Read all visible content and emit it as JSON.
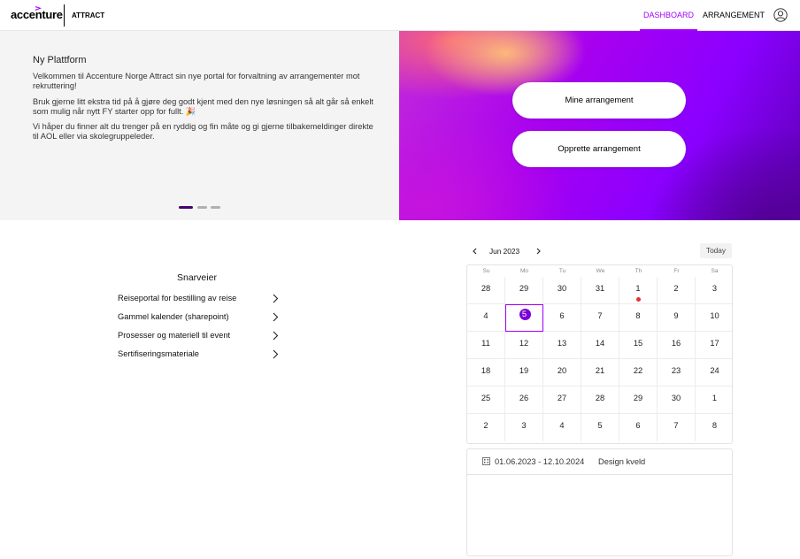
{
  "header": {
    "logo": "accenture",
    "app_name": "ATTRACT",
    "nav": {
      "dashboard": "DASHBOARD",
      "arrangement": "ARRANGEMENT"
    },
    "active_tab": "DASHBOARD",
    "accent_color": "#a100ff",
    "user_icon": "user-circle-icon"
  },
  "hero": {
    "title": "Ny Plattform",
    "paragraphs": [
      "Velkommen til Accenture Norge Attract sin nye portal for forvaltning av arrangementer mot rekruttering!",
      "Bruk gjerne litt ekstra tid på å gjøre deg godt kjent med den nye løsningen så alt går så enkelt som mulig når nytt FY starter opp for fullt. 🎉",
      "Vi håper du finner alt du trenger på en ryddig og fin måte og gi gjerne tilbakemeldinger direkte til AOL eller via skolegruppeleder."
    ],
    "carousel": {
      "slides": 3,
      "active": 1
    },
    "buttons": {
      "mine": "Mine arrangement",
      "opprett": "Opprette arrangement"
    }
  },
  "shortcuts": {
    "title": "Snarveier",
    "items": [
      {
        "label": "Reiseportal for bestilling av reise"
      },
      {
        "label": "Gammel kalender (sharepoint)"
      },
      {
        "label": "Prosesser og materiell til event"
      },
      {
        "label": "Sertifiseringsmateriale"
      }
    ]
  },
  "calendar": {
    "month_label": "Jun 2023",
    "today_label": "Today",
    "weekdays": [
      "Su",
      "Mo",
      "Tu",
      "We",
      "Th",
      "Fr",
      "Sa"
    ],
    "weeks": [
      [
        "28",
        "29",
        "30",
        "31",
        "1",
        "2",
        "3"
      ],
      [
        "4",
        "5",
        "6",
        "7",
        "8",
        "9",
        "10"
      ],
      [
        "11",
        "12",
        "13",
        "14",
        "15",
        "16",
        "17"
      ],
      [
        "18",
        "19",
        "20",
        "21",
        "22",
        "23",
        "24"
      ],
      [
        "25",
        "26",
        "27",
        "28",
        "29",
        "30",
        "1"
      ],
      [
        "2",
        "3",
        "4",
        "5",
        "6",
        "7",
        "8"
      ]
    ],
    "selected": {
      "week": 1,
      "day": 1
    },
    "event_markers": [
      {
        "week": 0,
        "day": 4,
        "color": "#e33333"
      }
    ]
  },
  "events": [
    {
      "dates": "01.06.2023 - 12.10.2024",
      "name": "Design kveld"
    }
  ]
}
